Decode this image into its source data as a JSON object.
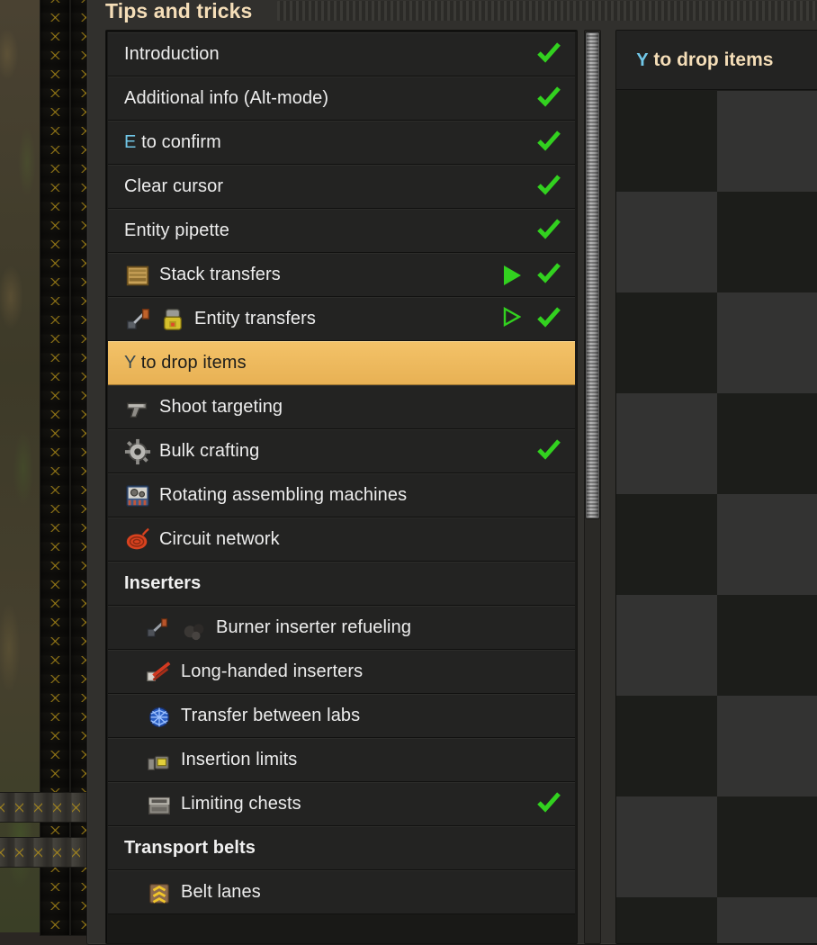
{
  "window": {
    "title": "Tips and tricks",
    "drag_handle": "window-drag-handle"
  },
  "colors": {
    "accent_title": "#f5deb8",
    "selection": "#edb659",
    "keybind": "#71c7e8",
    "check_green": "#32d11f",
    "row_bg": "#232322",
    "panel_bg": "#191917"
  },
  "list": {
    "items": [
      {
        "label": "Introduction",
        "icons": [],
        "kind": "item",
        "key": "",
        "play": "",
        "done": true
      },
      {
        "label": "Additional info (Alt-mode)",
        "icons": [],
        "kind": "item",
        "key": "",
        "play": "",
        "done": true
      },
      {
        "label": "to confirm",
        "icons": [],
        "kind": "item",
        "key": "E",
        "play": "",
        "done": true
      },
      {
        "label": "Clear cursor",
        "icons": [],
        "kind": "item",
        "key": "",
        "play": "",
        "done": true
      },
      {
        "label": "Entity pipette",
        "icons": [],
        "kind": "item",
        "key": "",
        "play": "",
        "done": true
      },
      {
        "label": "Stack transfers",
        "icons": [
          "wooden-chest-icon"
        ],
        "kind": "item",
        "key": "",
        "play": "filled",
        "done": true
      },
      {
        "label": "Entity transfers",
        "icons": [
          "inserter-icon",
          "car-icon"
        ],
        "kind": "item",
        "key": "",
        "play": "outline",
        "done": true
      },
      {
        "label": "to drop items",
        "icons": [],
        "kind": "selected",
        "key": "Y",
        "play": "",
        "done": false
      },
      {
        "label": "Shoot targeting",
        "icons": [
          "pistol-icon"
        ],
        "kind": "item",
        "key": "",
        "play": "",
        "done": false
      },
      {
        "label": "Bulk crafting",
        "icons": [
          "gear-wheel-icon"
        ],
        "kind": "item",
        "key": "",
        "play": "",
        "done": true
      },
      {
        "label": "Rotating assembling machines",
        "icons": [
          "assembling-machine-icon"
        ],
        "kind": "item",
        "key": "",
        "play": "",
        "done": false
      },
      {
        "label": "Circuit network",
        "icons": [
          "red-wire-icon"
        ],
        "kind": "item",
        "key": "",
        "play": "",
        "done": false
      },
      {
        "label": "Inserters",
        "icons": [],
        "kind": "header",
        "key": "",
        "play": "",
        "done": false
      },
      {
        "label": "Burner inserter refueling",
        "icons": [
          "burner-inserter-icon",
          "coal-icon"
        ],
        "kind": "sub",
        "key": "",
        "play": "",
        "done": false
      },
      {
        "label": "Long-handed inserters",
        "icons": [
          "long-inserter-icon"
        ],
        "kind": "sub",
        "key": "",
        "play": "",
        "done": false
      },
      {
        "label": "Transfer between labs",
        "icons": [
          "science-pack-icon"
        ],
        "kind": "sub",
        "key": "",
        "play": "",
        "done": false
      },
      {
        "label": "Insertion limits",
        "icons": [
          "yellow-inserter-icon"
        ],
        "kind": "sub",
        "key": "",
        "play": "",
        "done": false
      },
      {
        "label": "Limiting chests",
        "icons": [
          "iron-chest-icon"
        ],
        "kind": "sub",
        "key": "",
        "play": "",
        "done": true
      },
      {
        "label": "Transport belts",
        "icons": [],
        "kind": "header",
        "key": "",
        "play": "",
        "done": false
      },
      {
        "label": "Belt lanes",
        "icons": [
          "transport-belt-icon"
        ],
        "kind": "sub",
        "key": "",
        "play": "",
        "done": false
      }
    ]
  },
  "preview": {
    "key": "Y",
    "title": "to drop items"
  },
  "scrollbar": {
    "thumb_name": "vertical-scroll-thumb"
  }
}
